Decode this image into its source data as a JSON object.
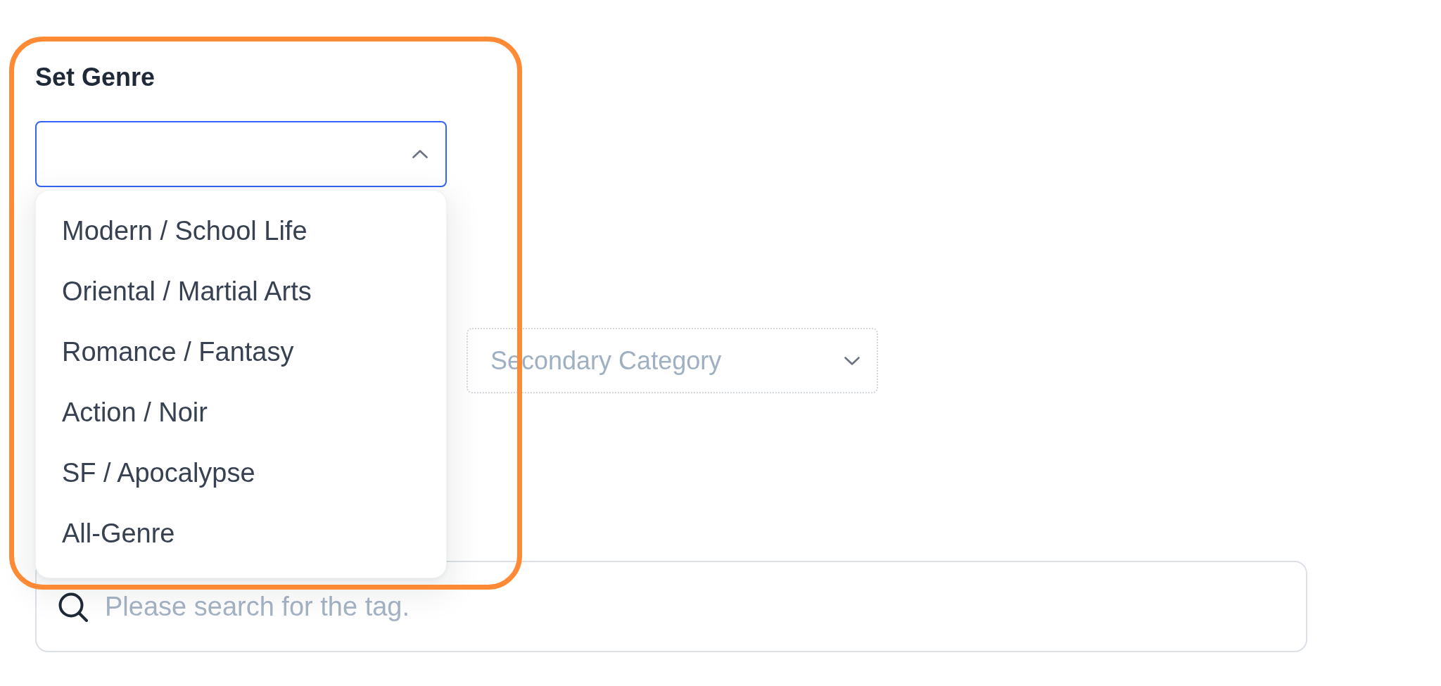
{
  "genre_field": {
    "label": "Set Genre",
    "expanded": true,
    "options": [
      {
        "label": "Modern / School Life",
        "selected": false
      },
      {
        "label": "Oriental / Martial Arts",
        "selected": false
      },
      {
        "label": "Romance / Fantasy",
        "selected": false
      },
      {
        "label": "Action / Noir",
        "selected": false
      },
      {
        "label": "SF / Apocalypse",
        "selected": false
      },
      {
        "label": "All-Genre",
        "selected": false
      }
    ]
  },
  "category_row": {
    "secondary": {
      "placeholder": "Secondary Category",
      "disabled": true
    }
  },
  "tag_search": {
    "placeholder": "Please search for the tag."
  },
  "annotation": {
    "kind": "frame"
  }
}
